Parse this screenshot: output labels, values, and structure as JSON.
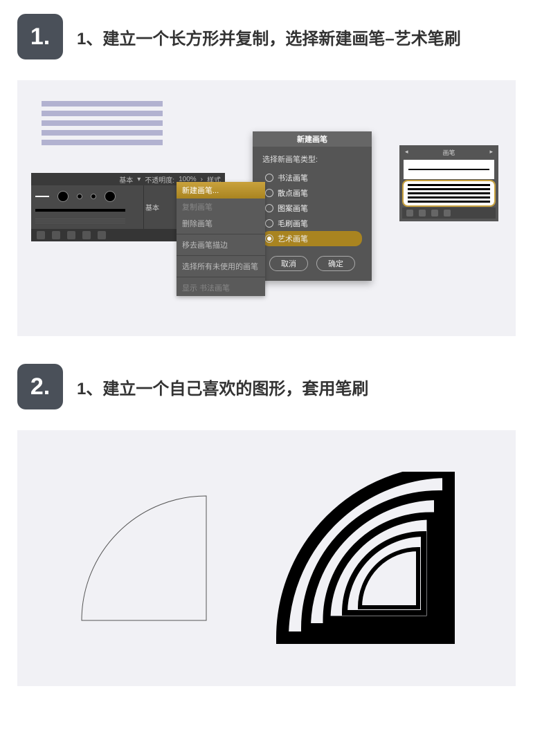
{
  "step1": {
    "number": "1.",
    "title": "1、建立一个长方形并复制，选择新建画笔–艺术笔刷",
    "panel_top": {
      "basic": "基本",
      "opacity": "不透明度:",
      "value": "100%",
      "sample": "样式"
    },
    "panel_side": "基本",
    "context_menu": {
      "new_brush": "新建画笔...",
      "dup": "复制画笔",
      "remove": "删除画笔",
      "clear": "移去画笔描边",
      "select_unused": "选择所有未使用的画笔",
      "last": "显示 书法画笔"
    },
    "dialog": {
      "title": "新建画笔",
      "label": "选择新画笔类型:",
      "options": [
        "书法画笔",
        "散点画笔",
        "图案画笔",
        "毛刷画笔",
        "艺术画笔"
      ],
      "cancel": "取消",
      "ok": "确定"
    },
    "preview_head": "画笔"
  },
  "step2": {
    "number": "2.",
    "title": "1、建立一个自己喜欢的图形，套用笔刷"
  }
}
